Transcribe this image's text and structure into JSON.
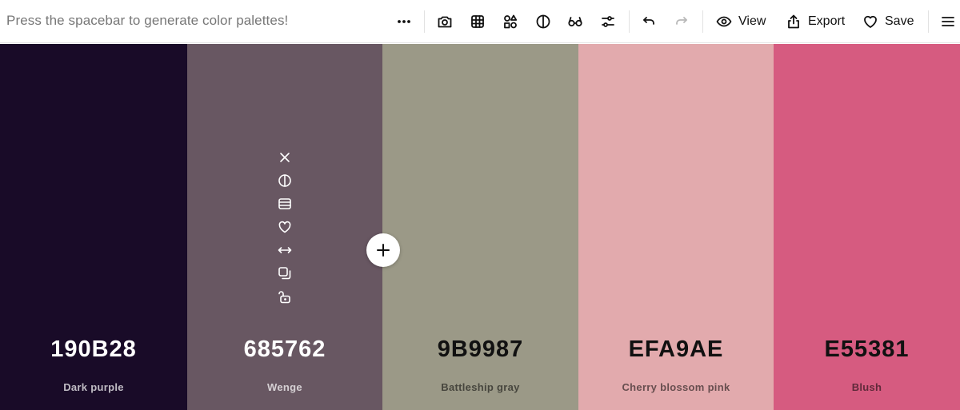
{
  "toolbar": {
    "hint": "Press the spacebar to generate color palettes!",
    "view_label": "View",
    "export_label": "Export",
    "save_label": "Save",
    "icons": [
      "more-icon",
      "camera-icon",
      "grid-icon",
      "shapes-icon",
      "contrast-icon",
      "glasses-icon",
      "sliders-icon",
      "undo-icon",
      "redo-icon",
      "eye-icon",
      "export-icon",
      "heart-icon",
      "menu-icon"
    ]
  },
  "palette": {
    "colors": [
      {
        "hex": "190B28",
        "name": "Dark purple",
        "bg": "#190B28"
      },
      {
        "hex": "685762",
        "name": "Wenge",
        "bg": "#685762"
      },
      {
        "hex": "9B9987",
        "name": "Battleship gray",
        "bg": "#9B9987"
      },
      {
        "hex": "EFA9AE",
        "name": "Cherry blossom pink",
        "bg": "#E2AAAD"
      },
      {
        "hex": "E55381",
        "name": "Blush",
        "bg": "#D65B80"
      }
    ],
    "swatch_tools": [
      "close-icon",
      "contrast-icon",
      "shades-icon",
      "heart-icon",
      "drag-icon",
      "copy-icon",
      "unlock-icon"
    ]
  }
}
